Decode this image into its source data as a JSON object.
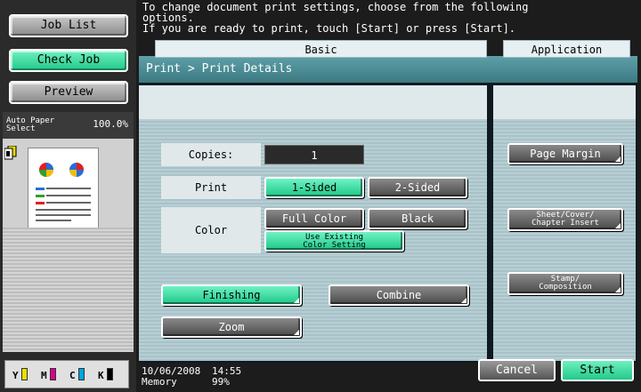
{
  "left": {
    "job_list": "Job List",
    "check_job": "Check Job",
    "preview": "Preview",
    "paper_line1": "Auto Paper",
    "paper_line2": "Select",
    "zoom": "100.0%",
    "toner": [
      "Y",
      "M",
      "C",
      "K"
    ]
  },
  "message": {
    "line1": "To change document print settings, choose from the following",
    "line2": "options.",
    "line3": "If you are ready to print, touch [Start] or press [Start]."
  },
  "panel": {
    "title": "Print > Print Details",
    "basic_tab": "Basic",
    "application_tab": "Application"
  },
  "basic": {
    "copies_label": "Copies:",
    "copies_value": "1",
    "print_label": "Print",
    "one_sided": "1-Sided",
    "two_sided": "2-Sided",
    "color_label": "Color",
    "full_color": "Full Color",
    "black": "Black",
    "use_existing_line1": "Use Existing",
    "use_existing_line2": "Color Setting",
    "finishing": "Finishing",
    "combine": "Combine",
    "zoom": "Zoom"
  },
  "application": {
    "page_margin": "Page Margin",
    "sheet_line1": "Sheet/Cover/",
    "sheet_line2": "Chapter Insert",
    "stamp_line1": "Stamp/",
    "stamp_line2": "Composition"
  },
  "footer": {
    "date": "10/06/2008",
    "time": "14:55",
    "memory_label": "Memory",
    "memory_value": "99%",
    "cancel": "Cancel",
    "start": "Start"
  },
  "colors": {
    "selected": "#1ec789",
    "title_bar": "#4e8e96",
    "toner_y": "#e8e000",
    "toner_m": "#d8008c",
    "toner_c": "#00a6e0",
    "toner_k": "#000000"
  }
}
